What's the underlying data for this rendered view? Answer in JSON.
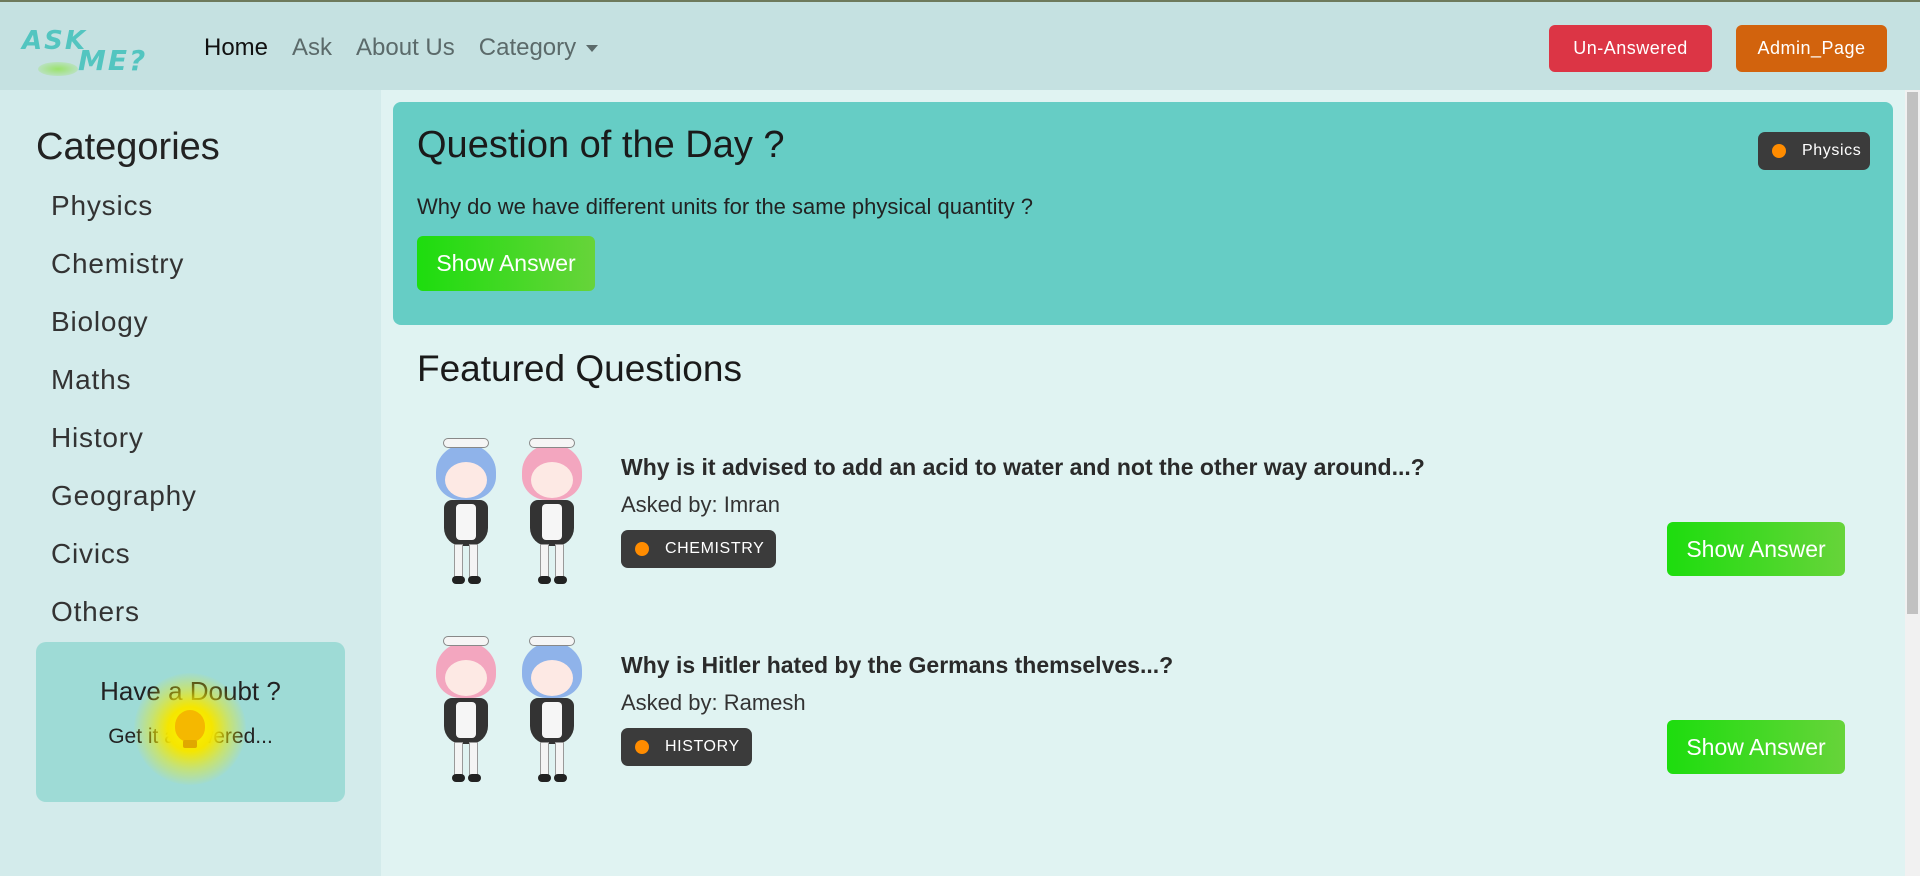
{
  "nav": {
    "logo_top": "ASK",
    "logo_bottom": "ME?",
    "links": [
      "Home",
      "Ask",
      "About Us",
      "Category"
    ],
    "unanswered_label": "Un-Answered",
    "admin_label": "Admin_Page"
  },
  "sidebar": {
    "title": "Categories",
    "categories": [
      "Physics",
      "Chemistry",
      "Biology",
      "Maths",
      "History",
      "Geography",
      "Civics",
      "Others"
    ],
    "doubt_title": "Have a Doubt ?",
    "doubt_sub": "Get it answered..."
  },
  "qotd": {
    "title": "Question of the Day ?",
    "question": "Why do we have different units for the same physical quantity ?",
    "button": "Show Answer",
    "badge": "Physics"
  },
  "featured": {
    "title": "Featured Questions",
    "items": [
      {
        "question": "Why is it advised to add an acid to water and not the other way around...?",
        "asked_by": "Asked by: Imran",
        "badge": "CHEMISTRY",
        "button": "Show Answer"
      },
      {
        "question": "Why is Hitler hated by the Germans themselves...?",
        "asked_by": "Asked by: Ramesh",
        "badge": "HISTORY",
        "button": "Show Answer"
      }
    ]
  },
  "colors": {
    "navbar_bg": "#c5e1e1",
    "qotd_bg": "#66cdc5",
    "danger": "#dc3545",
    "admin_orange": "#d2630d",
    "green_button": "#1ddd0e",
    "badge_dot": "#ff8c00"
  },
  "icons": {
    "dropdown": "chevron-down-icon",
    "bulb": "lightbulb-icon"
  }
}
